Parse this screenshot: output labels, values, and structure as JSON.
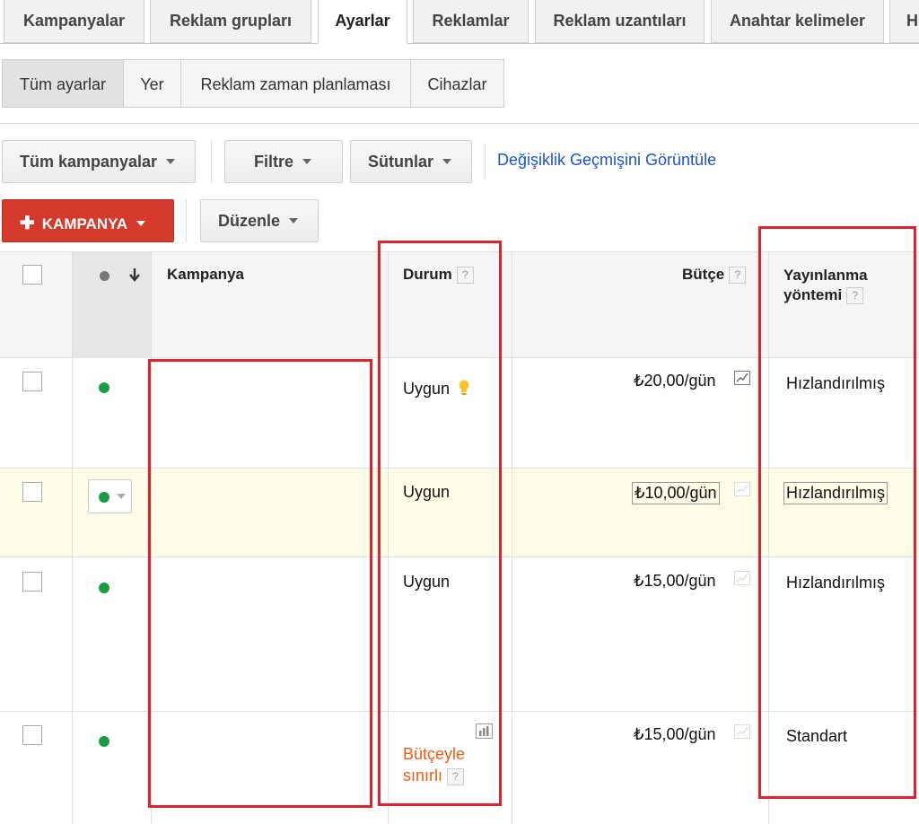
{
  "tabs": [
    "Kampanyalar",
    "Reklam grupları",
    "Ayarlar",
    "Reklamlar",
    "Reklam uzantıları",
    "Anahtar kelimeler",
    "H"
  ],
  "active_tab": "Ayarlar",
  "subtabs": [
    "Tüm ayarlar",
    "Yer",
    "Reklam zaman planlaması",
    "Cihazlar"
  ],
  "toolbar": {
    "all_campaigns": "Tüm kampanyalar",
    "filter": "Filtre",
    "columns": "Sütunlar",
    "history_link": "Değişiklik Geçmişini Görüntüle",
    "add_campaign": "KAMPANYA",
    "edit": "Düzenle"
  },
  "table": {
    "headers": {
      "campaign": "Kampanya",
      "status": "Durum",
      "budget": "Bütçe",
      "delivery_line1": "Yayınlanma",
      "delivery_line2": "yöntemi",
      "help": "?"
    },
    "rows": [
      {
        "status": "Uygun",
        "status_icon": "lightbulb-icon",
        "budget": "₺20,00/gün",
        "delivery": "Hızlandırılmış"
      },
      {
        "status": "Uygun",
        "budget": "₺10,00/gün",
        "delivery": "Hızlandırılmış",
        "highlighted": true
      },
      {
        "status": "Uygun",
        "budget": "₺15,00/gün",
        "delivery": "Hızlandırılmış"
      },
      {
        "status_line1": "Bütçeyle",
        "status_line2": "sınırlı",
        "status_color": "#ee5c13",
        "budget": "₺15,00/gün",
        "delivery": "Standart"
      }
    ]
  },
  "colors": {
    "accent_red": "#d4392b",
    "highlight_box": "#e3202b",
    "link_blue": "#1a55c7",
    "active_dot": "#1a9c43",
    "limited_orange": "#ee5c13",
    "row_highlight": "#fdfde8"
  }
}
